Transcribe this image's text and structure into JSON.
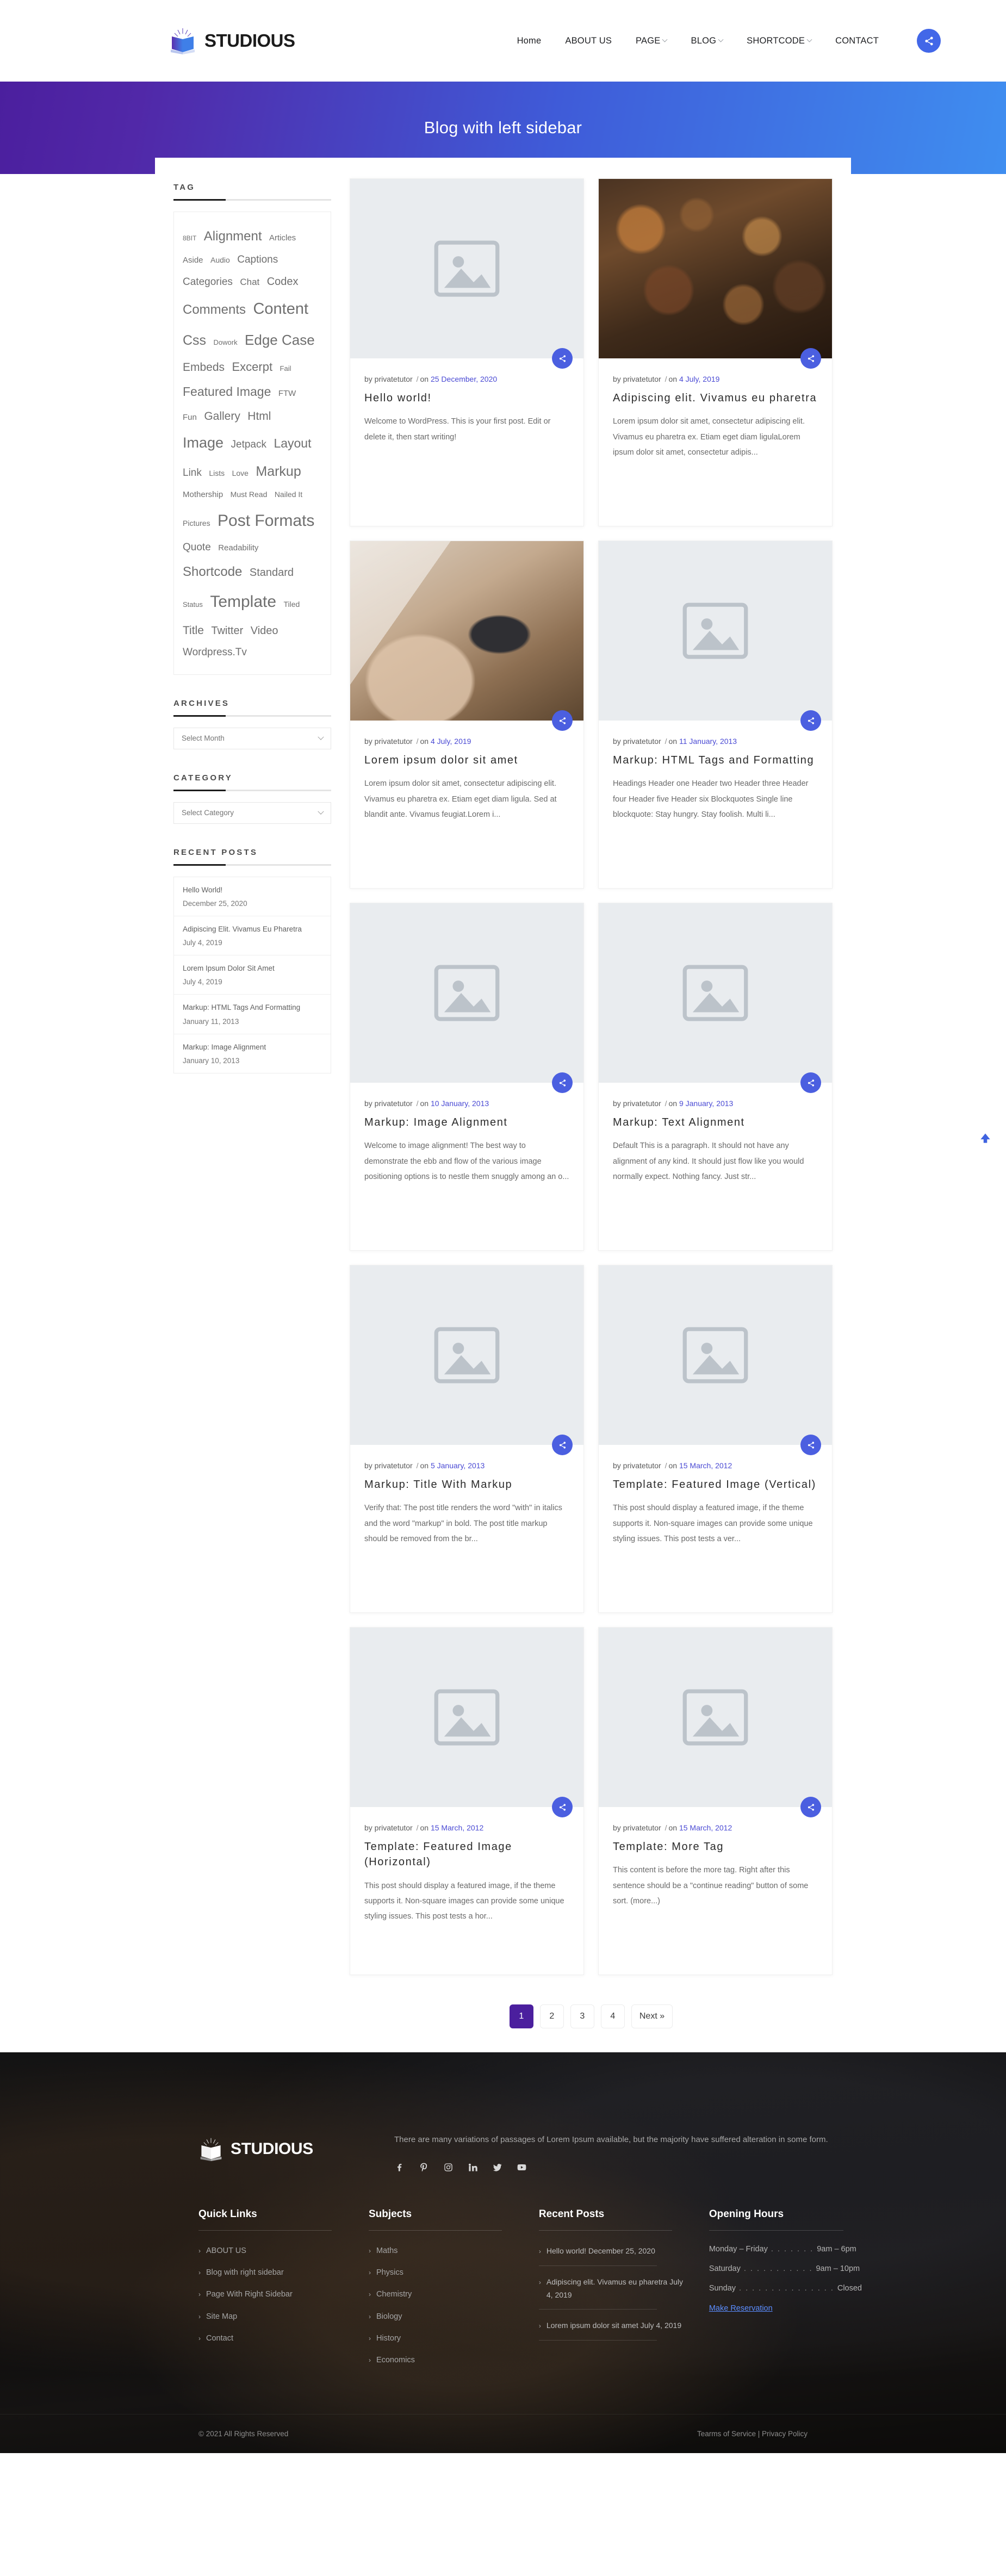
{
  "header": {
    "brand": "STUDIOUS",
    "nav": [
      {
        "label": "Home",
        "caret": false
      },
      {
        "label": "ABOUT US",
        "caret": false
      },
      {
        "label": "PAGE",
        "caret": true
      },
      {
        "label": "BLOG",
        "caret": true
      },
      {
        "label": "SHORTCODE",
        "caret": true
      },
      {
        "label": "CONTACT",
        "caret": false
      }
    ],
    "share_icon": "share-icon"
  },
  "hero": {
    "title": "Blog with left sidebar"
  },
  "sidebar": {
    "tag": {
      "title": "TAG",
      "items": [
        {
          "label": "8BIT",
          "size": 12
        },
        {
          "label": "Alignment",
          "size": 24
        },
        {
          "label": "Articles",
          "size": 15
        },
        {
          "label": "Aside",
          "size": 15
        },
        {
          "label": "Audio",
          "size": 14
        },
        {
          "label": "Captions",
          "size": 19
        },
        {
          "label": "Categories",
          "size": 19
        },
        {
          "label": "Chat",
          "size": 17
        },
        {
          "label": "Codex",
          "size": 20
        },
        {
          "label": "Comments",
          "size": 24
        },
        {
          "label": "Content",
          "size": 29
        },
        {
          "label": "Css",
          "size": 25
        },
        {
          "label": "Dowork",
          "size": 13
        },
        {
          "label": "Edge Case",
          "size": 26
        },
        {
          "label": "Embeds",
          "size": 21
        },
        {
          "label": "Excerpt",
          "size": 22
        },
        {
          "label": "Fail",
          "size": 13
        },
        {
          "label": "Featured Image",
          "size": 23
        },
        {
          "label": "FTW",
          "size": 15
        },
        {
          "label": "Fun",
          "size": 15
        },
        {
          "label": "Gallery",
          "size": 21
        },
        {
          "label": "Html",
          "size": 21
        },
        {
          "label": "Image",
          "size": 27
        },
        {
          "label": "Jetpack",
          "size": 19
        },
        {
          "label": "Layout",
          "size": 23
        },
        {
          "label": "Link",
          "size": 19
        },
        {
          "label": "Lists",
          "size": 14
        },
        {
          "label": "Love",
          "size": 14
        },
        {
          "label": "Markup",
          "size": 25
        },
        {
          "label": "Mothership",
          "size": 15
        },
        {
          "label": "Must Read",
          "size": 14
        },
        {
          "label": "Nailed It",
          "size": 14
        },
        {
          "label": "Pictures",
          "size": 14
        },
        {
          "label": "Post Formats",
          "size": 30
        },
        {
          "label": "Quote",
          "size": 19
        },
        {
          "label": "Readability",
          "size": 15
        },
        {
          "label": "Shortcode",
          "size": 24
        },
        {
          "label": "Standard",
          "size": 20
        },
        {
          "label": "Status",
          "size": 13
        },
        {
          "label": "Template",
          "size": 30
        },
        {
          "label": "Tiled",
          "size": 14
        },
        {
          "label": "Title",
          "size": 21
        },
        {
          "label": "Twitter",
          "size": 20
        },
        {
          "label": "Video",
          "size": 20
        },
        {
          "label": "Wordpress.Tv",
          "size": 19
        }
      ]
    },
    "archives": {
      "title": "ARCHIVES",
      "select_value": "Select Month"
    },
    "category": {
      "title": "CATEGORY",
      "select_value": "Select Category"
    },
    "recent_posts": {
      "title": "RECENT POSTS",
      "items": [
        {
          "title": "Hello World!",
          "date": "December 25, 2020"
        },
        {
          "title": "Adipiscing Elit. Vivamus Eu Pharetra",
          "date": "July 4, 2019"
        },
        {
          "title": "Lorem Ipsum Dolor Sit Amet",
          "date": "July 4, 2019"
        },
        {
          "title": "Markup: HTML Tags And Formatting",
          "date": "January 11, 2013"
        },
        {
          "title": "Markup: Image Alignment",
          "date": "January 10, 2013"
        }
      ]
    }
  },
  "posts": [
    {
      "author": "by privatetutor",
      "date": "25 December, 2020",
      "title": "Hello world!",
      "excerpt": "Welcome to WordPress. This is your first post. Edit or delete it, then start writing!",
      "thumb": "placeholder"
    },
    {
      "author": "by privatetutor",
      "date": "4 July, 2019",
      "title": "Adipiscing elit. Vivamus eu pharetra",
      "excerpt": "Lorem ipsum dolor sit amet, consectetur adipiscing elit. Vivamus eu pharetra ex. Etiam eget diam ligulaLorem ipsum dolor sit amet, consectetur adipis...",
      "thumb": "photo-1"
    },
    {
      "author": "by privatetutor",
      "date": "4 July, 2019",
      "title": "Lorem ipsum dolor sit amet",
      "excerpt": "Lorem ipsum dolor sit amet, consectetur adipiscing elit. Vivamus eu pharetra ex. Etiam eget diam ligula. Sed at blandit ante. Vivamus feugiat.Lorem i...",
      "thumb": "photo-2"
    },
    {
      "author": "by privatetutor",
      "date": "11 January, 2013",
      "title": "Markup: HTML Tags and Formatting",
      "excerpt": "Headings Header one Header two Header three Header four Header five Header six Blockquotes Single line blockquote: Stay hungry. Stay foolish. Multi li...",
      "thumb": "placeholder"
    },
    {
      "author": "by privatetutor",
      "date": "10 January, 2013",
      "title": "Markup: Image Alignment",
      "excerpt": "Welcome to image alignment! The best way to demonstrate the ebb and flow of the various image positioning options is to nestle them snuggly among an o...",
      "thumb": "placeholder"
    },
    {
      "author": "by privatetutor",
      "date": "9 January, 2013",
      "title": "Markup: Text Alignment",
      "excerpt": "Default This is a paragraph. It should not have any alignment of any kind. It should just flow like you would normally expect. Nothing fancy. Just str...",
      "thumb": "placeholder"
    },
    {
      "author": "by privatetutor",
      "date": "5 January, 2013",
      "title": "Markup: Title With Markup",
      "excerpt": "Verify that: The post title renders the word \"with\" in italics and the word \"markup\" in bold. The post title markup should be removed from the br...",
      "thumb": "placeholder"
    },
    {
      "author": "by privatetutor",
      "date": "15 March, 2012",
      "title": "Template: Featured Image (Vertical)",
      "excerpt": "This post should display a featured image, if the theme supports it. Non-square images can provide some unique styling issues. This post tests a ver...",
      "thumb": "placeholder"
    },
    {
      "author": "by privatetutor",
      "date": "15 March, 2012",
      "title": "Template: Featured Image (Horizontal)",
      "excerpt": "This post should display a featured image, if the theme supports it. Non-square images can provide some unique styling issues. This post tests a hor...",
      "thumb": "placeholder"
    },
    {
      "author": "by privatetutor",
      "date": "15 March, 2012",
      "title": "Template: More Tag",
      "excerpt": "This content is before the more tag. Right after this sentence should be a \"continue reading\" button of some sort. (more...)",
      "thumb": "placeholder"
    }
  ],
  "pagination": {
    "pages": [
      "1",
      "2",
      "3",
      "4"
    ],
    "next_label": "Next »",
    "active": "1"
  },
  "footer": {
    "brand": "STUDIOUS",
    "about": "There are many variations of passages of Lorem Ipsum available, but the majority have suffered alteration in some form.",
    "socials": [
      "facebook-icon",
      "pinterest-icon",
      "instagram-icon",
      "linkedin-icon",
      "twitter-icon",
      "youtube-icon"
    ],
    "quick_links": {
      "title": "Quick Links",
      "items": [
        "ABOUT US",
        "Blog with right sidebar",
        "Page With Right Sidebar",
        "Site Map",
        "Contact"
      ]
    },
    "subjects": {
      "title": "Subjects",
      "items": [
        "Maths",
        "Physics",
        "Chemistry",
        "Biology",
        "History",
        "Economics"
      ]
    },
    "recent_posts": {
      "title": "Recent Posts",
      "items": [
        "Hello world! December 25, 2020",
        "Adipiscing elit. Vivamus eu pharetra July 4, 2019",
        "Lorem ipsum dolor sit amet July 4, 2019"
      ]
    },
    "opening_hours": {
      "title": "Opening Hours",
      "rows": [
        {
          "day": "Monday – Friday",
          "dots": ". . . . . . .",
          "time": "9am – 6pm"
        },
        {
          "day": "Saturday",
          "dots": ". . . . . . . . . . .",
          "time": "9am – 10pm"
        },
        {
          "day": "Sunday",
          "dots": ". . . . . . . . . . . . . . .",
          "time": "Closed"
        }
      ],
      "reserve_label": "Make Reservation"
    },
    "copyright": "© 2021 All Rights Reserved",
    "legal": "Tearms of Service | Privacy Policy"
  },
  "colors": {
    "accent_blue": "#4b5fe0",
    "hero_purple": "#4b1f9e",
    "hero_blue": "#3f8ef0",
    "date_link": "#4a4ad4"
  }
}
